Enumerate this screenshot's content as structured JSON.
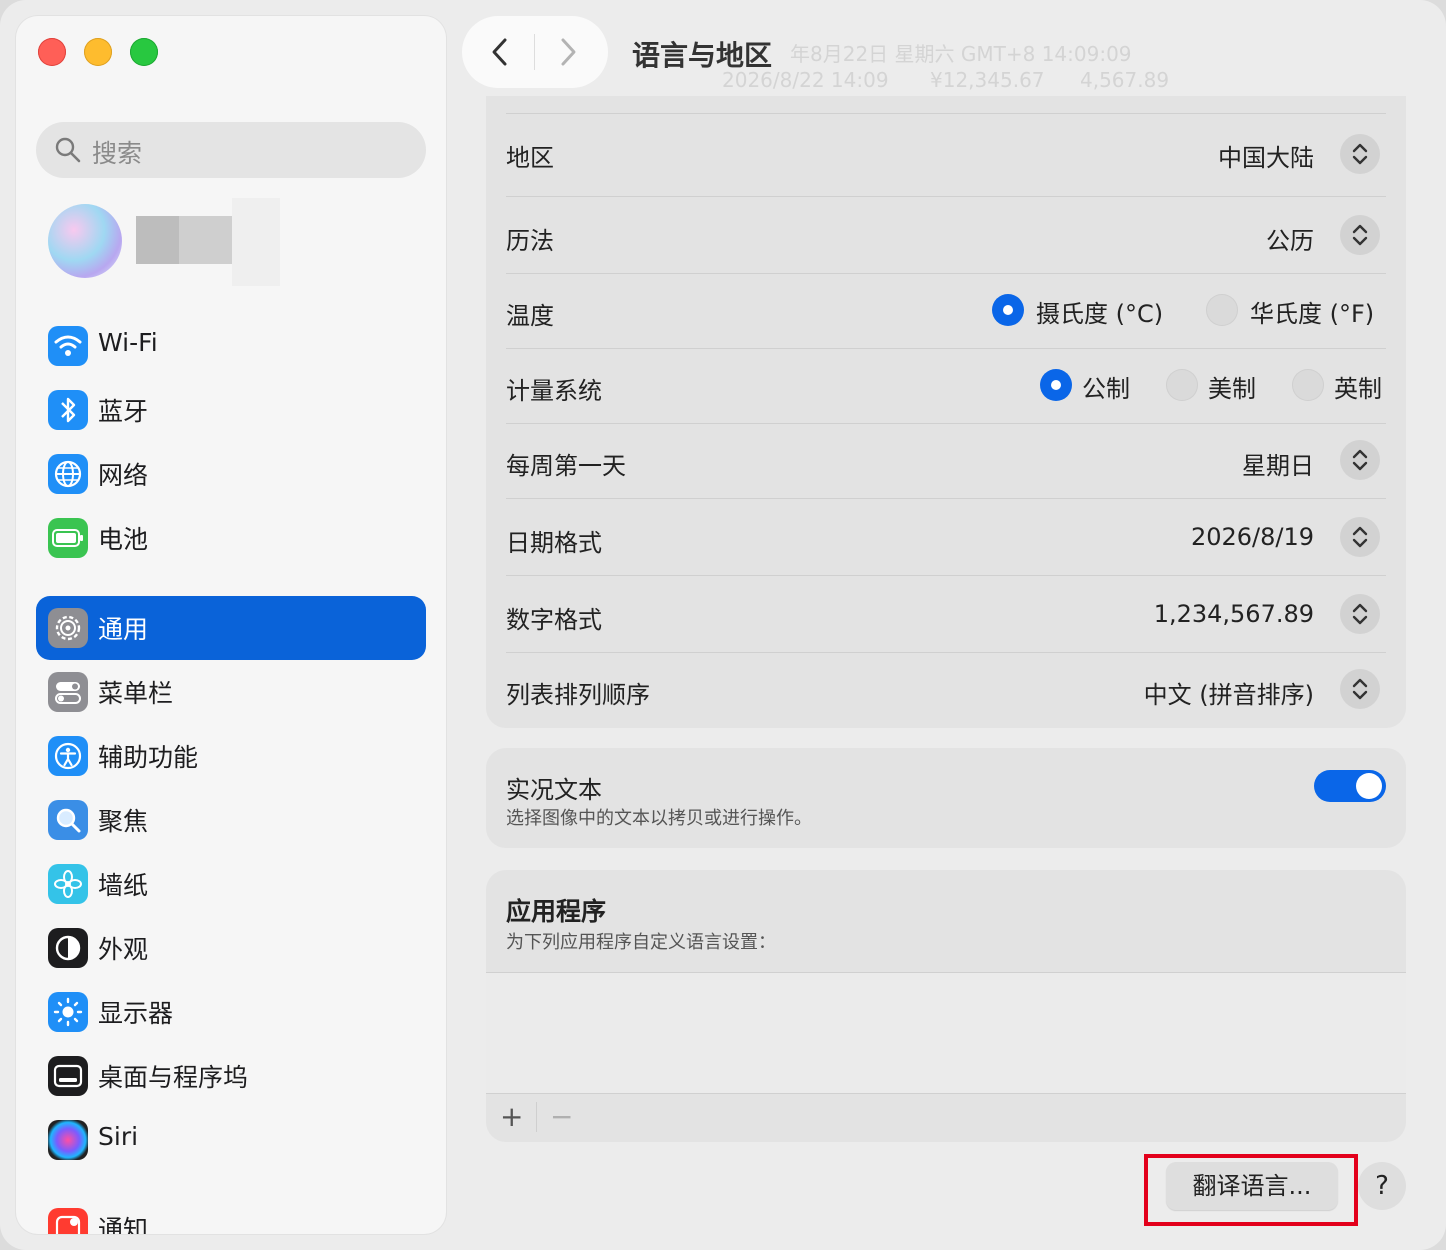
{
  "window": {
    "title": "语言与地区",
    "ghost_line1": "年8月22日 星期六 GMT+8 14:09:09",
    "ghost_line2": [
      "2026/8/22 14:09",
      "¥12,345.67",
      "4,567.89"
    ]
  },
  "sidebar": {
    "search_placeholder": "搜索",
    "items": [
      {
        "label": "Wi-Fi",
        "icon": "wifi-icon",
        "color": "#1f8ff7"
      },
      {
        "label": "蓝牙",
        "icon": "bluetooth-icon",
        "color": "#1f8ff7"
      },
      {
        "label": "网络",
        "icon": "globe-icon",
        "color": "#1f8ff7"
      },
      {
        "label": "电池",
        "icon": "battery-icon",
        "color": "#3ac451"
      },
      {
        "label": "通用",
        "icon": "gear-icon",
        "color": "#8e8e93",
        "active": true
      },
      {
        "label": "菜单栏",
        "icon": "menubar-icon",
        "color": "#8e8e93"
      },
      {
        "label": "辅助功能",
        "icon": "accessibility-icon",
        "color": "#1f8ff7"
      },
      {
        "label": "聚焦",
        "icon": "spotlight-icon",
        "color": "#3a8ee6"
      },
      {
        "label": "墙纸",
        "icon": "wallpaper-icon",
        "color": "#34c3e8"
      },
      {
        "label": "外观",
        "icon": "appearance-icon",
        "color": "#1d1d1f"
      },
      {
        "label": "显示器",
        "icon": "display-icon",
        "color": "#1f8ff7"
      },
      {
        "label": "桌面与程序坞",
        "icon": "dock-icon",
        "color": "#1d1d1f"
      },
      {
        "label": "Siri",
        "icon": "siri-icon",
        "color": "#2a2a4a"
      },
      {
        "label": "通知",
        "icon": "notification-icon",
        "color": "#ff3b30"
      }
    ]
  },
  "settings": {
    "region": {
      "label": "地区",
      "value": "中国大陆"
    },
    "calendar": {
      "label": "历法",
      "value": "公历"
    },
    "temperature": {
      "label": "温度",
      "options": [
        "摄氏度 (°C)",
        "华氏度 (°F)"
      ],
      "selected": "摄氏度 (°C)"
    },
    "measurement": {
      "label": "计量系统",
      "options": [
        "公制",
        "美制",
        "英制"
      ],
      "selected": "公制"
    },
    "first_day": {
      "label": "每周第一天",
      "value": "星期日"
    },
    "date_format": {
      "label": "日期格式",
      "value": "2026/8/19"
    },
    "number_format": {
      "label": "数字格式",
      "value": "1,234,567.89"
    },
    "list_sort": {
      "label": "列表排列顺序",
      "value": "中文 (拼音排序)"
    }
  },
  "live_text": {
    "title": "实况文本",
    "subtitle": "选择图像中的文本以拷贝或进行操作。",
    "enabled": true
  },
  "apps": {
    "title": "应用程序",
    "subtitle": "为下列应用程序自定义语言设置：",
    "add": "+",
    "remove": "−"
  },
  "buttons": {
    "translate": "翻译语言...",
    "help": "?"
  },
  "colors": {
    "accent": "#0a63d9",
    "highlight_border": "#e3001b"
  }
}
